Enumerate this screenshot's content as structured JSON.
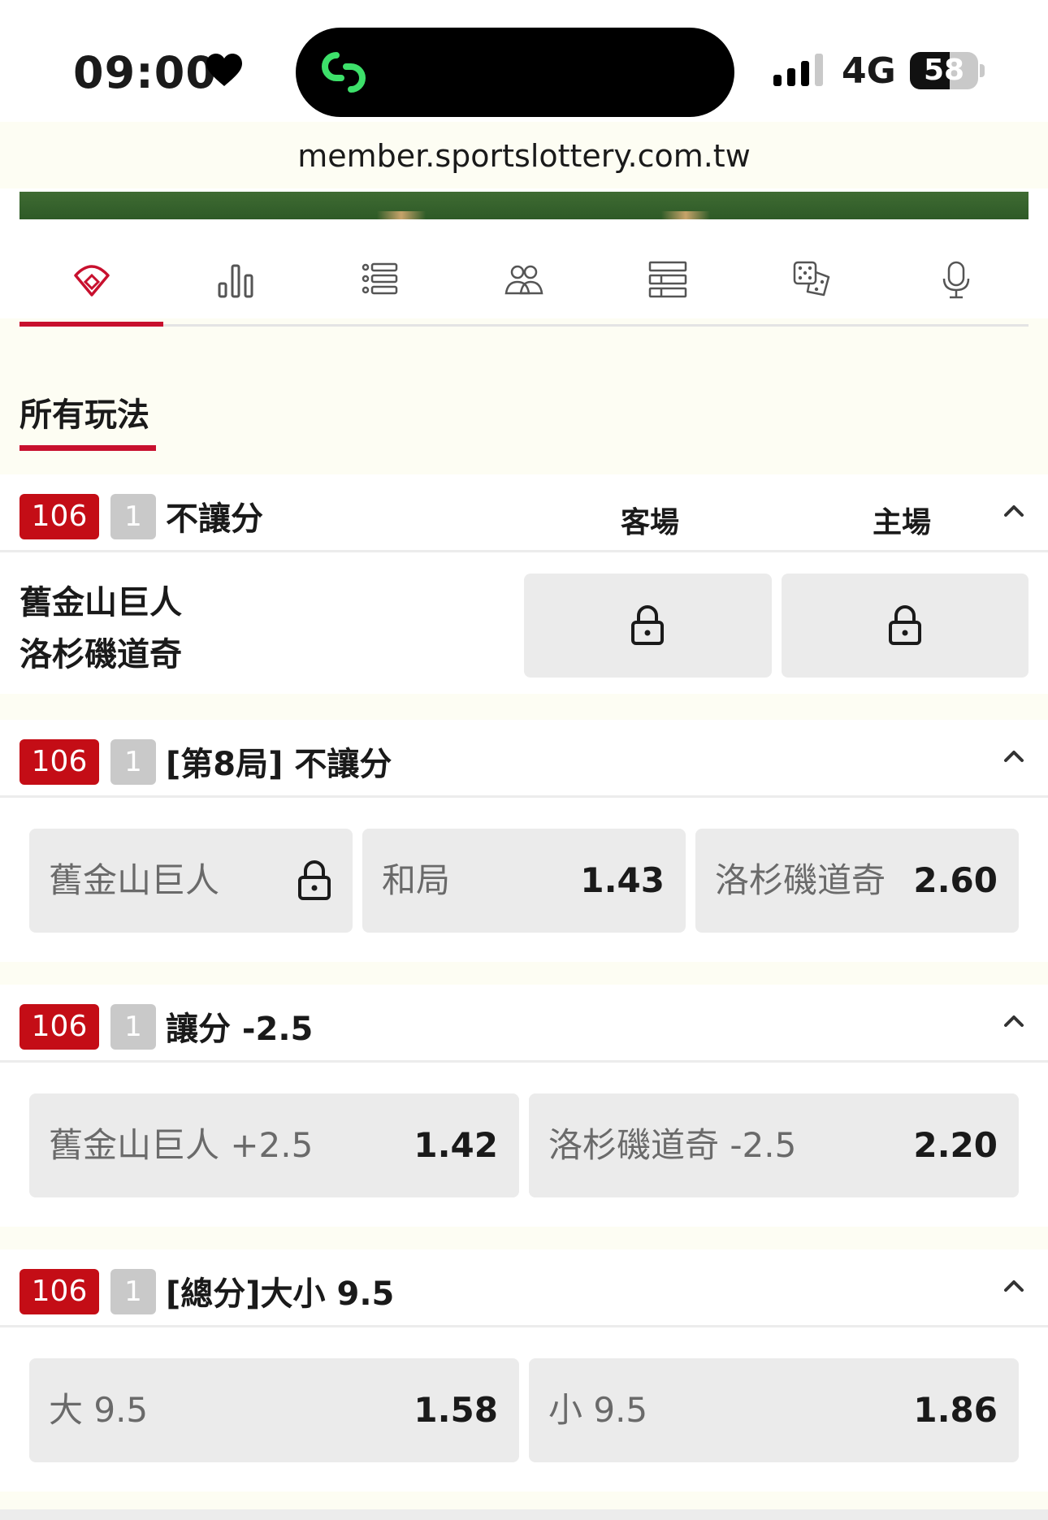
{
  "status_bar": {
    "time": "09:00",
    "network": "4G",
    "battery": "58",
    "battery_level": 0.58
  },
  "browser": {
    "url": "member.sportslottery.com.tw"
  },
  "nav_tabs": [
    {
      "icon": "baseball-field-icon",
      "active": true
    },
    {
      "icon": "bar-chart-icon",
      "active": false
    },
    {
      "icon": "list-icon",
      "active": false
    },
    {
      "icon": "players-icon",
      "active": false
    },
    {
      "icon": "table-icon",
      "active": false
    },
    {
      "icon": "dice-icon",
      "active": false
    },
    {
      "icon": "microphone-icon",
      "active": false
    }
  ],
  "section": {
    "title": "所有玩法"
  },
  "accent_color": "#c8102e",
  "markets": [
    {
      "code": "106",
      "number": "1",
      "name": "不讓分",
      "col_away": "客場",
      "col_home": "主場",
      "team_away": "舊金山巨人",
      "team_home": "洛杉磯道奇"
    },
    {
      "code": "106",
      "number": "1",
      "name": "[第8局] 不讓分",
      "options": [
        {
          "label": "舊金山巨人",
          "locked": true
        },
        {
          "label": "和局",
          "odds": "1.43"
        },
        {
          "label": "洛杉磯道奇",
          "odds": "2.60"
        }
      ]
    },
    {
      "code": "106",
      "number": "1",
      "name": "讓分 -2.5",
      "options": [
        {
          "label": "舊金山巨人 +2.5",
          "odds": "1.42"
        },
        {
          "label": "洛杉磯道奇 -2.5",
          "odds": "2.20"
        }
      ]
    },
    {
      "code": "106",
      "number": "1",
      "name": "[總分]大小 9.5",
      "options": [
        {
          "label": "大 9.5",
          "odds": "1.58"
        },
        {
          "label": "小 9.5",
          "odds": "1.86"
        }
      ]
    }
  ]
}
